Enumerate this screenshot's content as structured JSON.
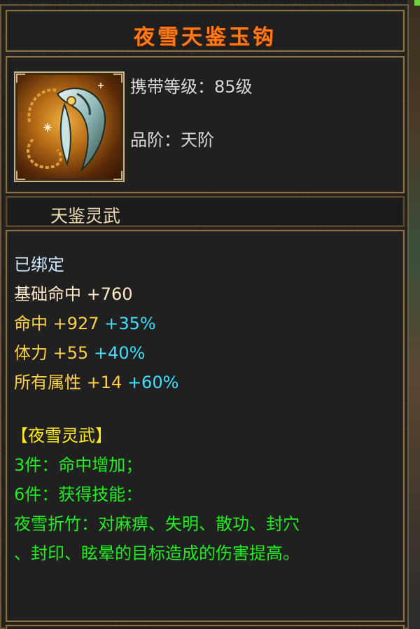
{
  "item": {
    "name": "夜雪天鉴玉钩",
    "icon": "jade-hook-weapon-icon",
    "level_label": "携带等级：",
    "level_value": "85级",
    "grade_label": "品阶：",
    "grade_value": "天阶",
    "category": "天鉴灵武"
  },
  "stats": {
    "bound": "已绑定",
    "base_hit_label": "基础命中",
    "base_hit_value": "+760",
    "hit_label": "命中",
    "hit_value": "+927",
    "hit_pct": "+35%",
    "stamina_label": "体力",
    "stamina_value": "+55",
    "stamina_pct": "+40%",
    "allattr_label": "所有属性",
    "allattr_value": "+14",
    "allattr_pct": "+60%"
  },
  "set": {
    "name": "【夜雪灵武】",
    "piece3": "3件：命中增加；",
    "piece6": "6件：获得技能：",
    "skill_line1": "夜雪折竹：对麻痹、失明、散功、封穴",
    "skill_line2": "、封印、眩晕的目标造成的伤害提高。"
  },
  "colors": {
    "title": "#ff7a1a",
    "yellow_stat": "#ffd24a",
    "cyan_bonus": "#3ee0ff",
    "green_set": "#22ee22"
  }
}
